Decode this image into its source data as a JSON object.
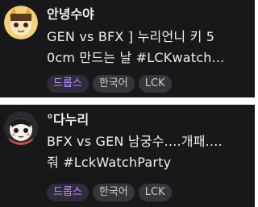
{
  "streams": [
    {
      "streamer": "안녕수야",
      "title_lines": [
        "GEN vs BFX ] 누리언니 키 5",
        "0cm 만드는 날 #LCKwatch..."
      ],
      "tags": [
        "드롭스",
        "한국어",
        "LCK"
      ]
    },
    {
      "streamer": "°다누리",
      "title_lines": [
        "BFX vs GEN 남궁수....개패....",
        "줘 #LckWatchParty"
      ],
      "tags": [
        "드롭스",
        "한국어",
        "LCK"
      ]
    }
  ],
  "colors": {
    "card_bg": "#18181b",
    "text": "#efeff1",
    "tag_bg": "#35353b",
    "accent": "#bf94ff"
  }
}
